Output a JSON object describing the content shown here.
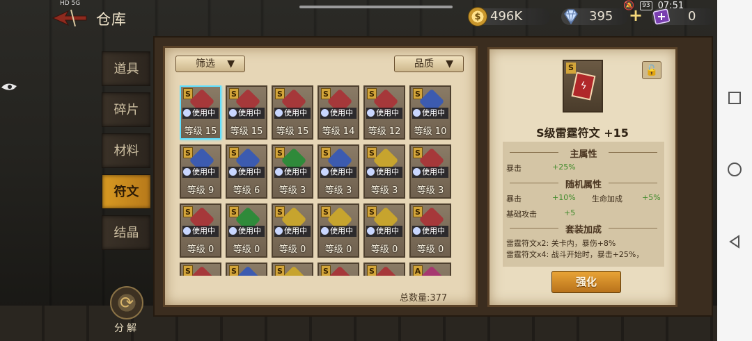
{
  "header": {
    "title": "仓库",
    "status_time": "07:51",
    "status_battery": "93",
    "status_network": "HD 5G"
  },
  "currencies": {
    "gold": "496K",
    "gems": "395",
    "tickets": "0"
  },
  "tabs": [
    {
      "label": "道具",
      "active": false
    },
    {
      "label": "碎片",
      "active": false
    },
    {
      "label": "材料",
      "active": false
    },
    {
      "label": "符文",
      "active": true
    },
    {
      "label": "结晶",
      "active": false
    }
  ],
  "decompose_label": "分解",
  "filters": {
    "filter_label": "筛选",
    "quality_label": "品质"
  },
  "grid": {
    "rank_letter": "S",
    "in_use_label": "使用中",
    "level_prefix": "等级",
    "cards": [
      {
        "level": "15",
        "rune_color": "#a6383a",
        "in_use": true,
        "selected": true
      },
      {
        "level": "15",
        "rune_color": "#a6383a",
        "in_use": true
      },
      {
        "level": "15",
        "rune_color": "#a6383a",
        "in_use": true
      },
      {
        "level": "14",
        "rune_color": "#a6383a",
        "in_use": true
      },
      {
        "level": "12",
        "rune_color": "#a6383a",
        "in_use": true
      },
      {
        "level": "10",
        "rune_color": "#3c5bb0",
        "in_use": true
      },
      {
        "level": "9",
        "rune_color": "#3c5bb0",
        "in_use": true
      },
      {
        "level": "6",
        "rune_color": "#3c5bb0",
        "in_use": true
      },
      {
        "level": "3",
        "rune_color": "#2f8a3a",
        "in_use": true
      },
      {
        "level": "3",
        "rune_color": "#3c5bb0",
        "in_use": true
      },
      {
        "level": "3",
        "rune_color": "#c7a42e",
        "in_use": true
      },
      {
        "level": "3",
        "rune_color": "#a6383a",
        "in_use": true
      },
      {
        "level": "0",
        "rune_color": "#a6383a",
        "in_use": true
      },
      {
        "level": "0",
        "rune_color": "#2f8a3a",
        "in_use": true
      },
      {
        "level": "0",
        "rune_color": "#c7a42e",
        "in_use": true
      },
      {
        "level": "0",
        "rune_color": "#c7a42e",
        "in_use": true
      },
      {
        "level": "0",
        "rune_color": "#c7a42e",
        "in_use": true
      },
      {
        "level": "0",
        "rune_color": "#a6383a",
        "in_use": true
      },
      {
        "level": "",
        "rune_color": "#a6383a",
        "in_use": false
      },
      {
        "level": "",
        "rune_color": "#3c5bb0",
        "in_use": false
      },
      {
        "level": "",
        "rune_color": "#c7a42e",
        "in_use": false
      },
      {
        "level": "",
        "rune_color": "#a6383a",
        "in_use": false
      },
      {
        "level": "",
        "rune_color": "#a6383a",
        "in_use": false
      },
      {
        "level": "",
        "rune_color": "#a63870",
        "in_use": false,
        "rank_letter": "A"
      }
    ]
  },
  "total_label": "总数量:377",
  "detail": {
    "rank_letter": "S",
    "name": "S级雷霆符文 +15",
    "main_title": "主属性",
    "main_stats": [
      {
        "name": "暴击",
        "value": "+25%"
      }
    ],
    "random_title": "随机属性",
    "random_stats": [
      {
        "name": "暴击",
        "value": "+10%"
      },
      {
        "name": "生命加成",
        "value": "+5%"
      },
      {
        "name": "基础攻击",
        "value": "+5"
      }
    ],
    "set_title": "套装加成",
    "set_lines": [
      "雷霆符文x2: 关卡内，暴伤+8%",
      "雷霆符文x4: 战斗开始时，暴击+25%，"
    ],
    "enhance_label": "强化"
  },
  "colors": {
    "accent_tab": "#d89a22",
    "selected_border": "#5fe0ff",
    "positive_stat": "#3f8a2a"
  }
}
